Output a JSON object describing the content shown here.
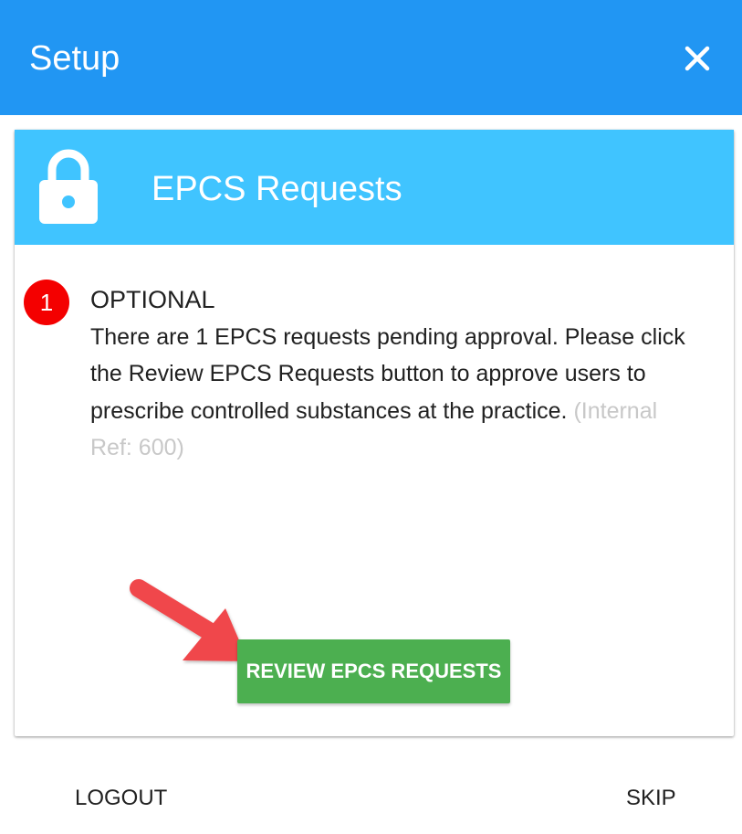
{
  "dialog": {
    "title": "Setup",
    "close_icon": "close-icon"
  },
  "card": {
    "header_icon": "lock-icon",
    "title": "EPCS Requests",
    "header_color": "#40c4ff"
  },
  "step": {
    "number": "1",
    "title": "OPTIONAL",
    "description": "There are 1 EPCS requests pending approval. Please click the Review EPCS Requests button to approve users to prescribe controlled substances at the practice.",
    "internal_ref": "(Internal Ref: 600)"
  },
  "actions": {
    "review_label": "REVIEW EPCS REQUESTS",
    "logout_label": "LOGOUT",
    "skip_label": "SKIP"
  },
  "colors": {
    "header": "#2196f3",
    "badge": "#f40000",
    "review_button": "#4caf50",
    "annotation_arrow": "#f0474b"
  }
}
